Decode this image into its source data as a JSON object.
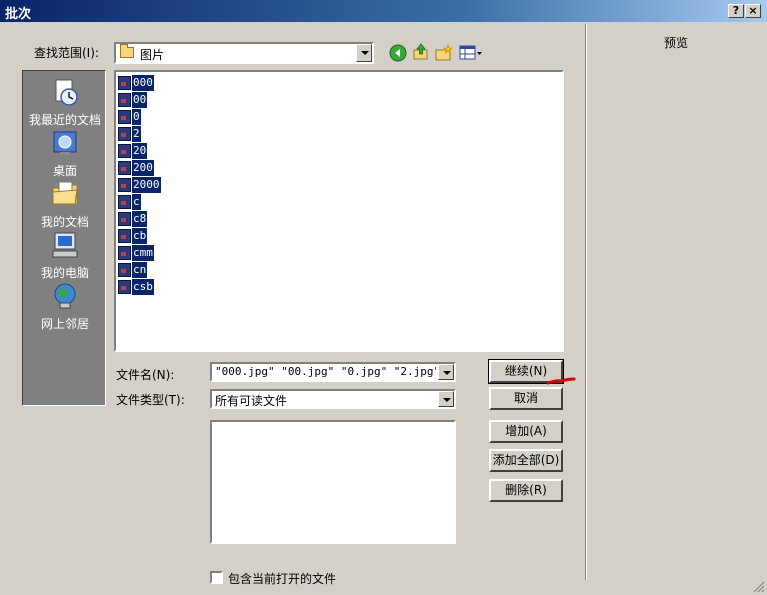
{
  "window": {
    "title": "批次",
    "help_glyph": "?",
    "close_glyph": "×"
  },
  "preview": {
    "label": "预览"
  },
  "lookin": {
    "label": "查找范围(I):",
    "value": "图片"
  },
  "toolbar": [
    {
      "name": "back-icon"
    },
    {
      "name": "up-folder-icon"
    },
    {
      "name": "new-folder-icon"
    },
    {
      "name": "view-menu-icon"
    }
  ],
  "places": [
    {
      "name": "place-recent",
      "label": "我最近的文档",
      "icon": "recent-documents-icon"
    },
    {
      "name": "place-desktop",
      "label": "桌面",
      "icon": "desktop-icon"
    },
    {
      "name": "place-my-documents",
      "label": "我的文档",
      "icon": "my-documents-icon"
    },
    {
      "name": "place-my-computer",
      "label": "我的电脑",
      "icon": "my-computer-icon"
    },
    {
      "name": "place-network",
      "label": "网上邻居",
      "icon": "network-places-icon"
    }
  ],
  "files": [
    "000",
    "00",
    "0",
    "2",
    "20",
    "200",
    "2000",
    "c",
    "c8",
    "cb",
    "cmm",
    "cn",
    "csb"
  ],
  "filename": {
    "label": "文件名(N):",
    "value": "\"000.jpg\" \"00.jpg\" \"0.jpg\" \"2.jpg\" \"20"
  },
  "filetype": {
    "label": "文件类型(T):",
    "value": "所有可读文件"
  },
  "buttons": {
    "continue": "继续(N)",
    "cancel": "取消",
    "add": "增加(A)",
    "add_all": "添加全部(D)",
    "remove": "删除(R)"
  },
  "checkbox": {
    "label": "包含当前打开的文件",
    "checked": false
  },
  "colors": {
    "title_start": "#0a246a",
    "selection": "#0a246a",
    "annotation": "#e00000",
    "face": "#d4d0c8"
  }
}
